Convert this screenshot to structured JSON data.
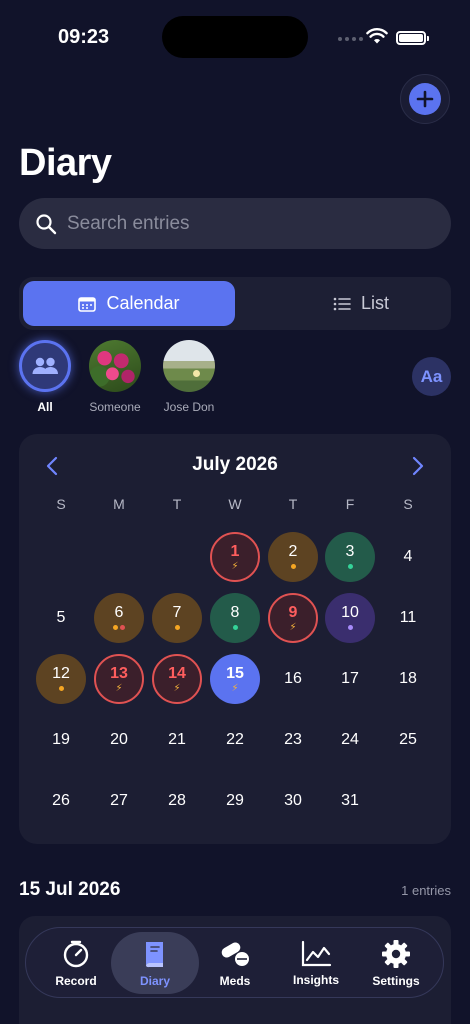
{
  "status": {
    "time": "09:23"
  },
  "header": {
    "title": "Diary"
  },
  "search": {
    "placeholder": "Search entries"
  },
  "view_toggle": {
    "calendar_label": "Calendar",
    "list_label": "List",
    "selected": "Calendar"
  },
  "people": [
    {
      "label": "All",
      "icon": "people-icon",
      "selected": true
    },
    {
      "label": "Someone",
      "icon": "flowers-photo"
    },
    {
      "label": "Jose Don",
      "icon": "meadow-photo"
    }
  ],
  "font_button": {
    "label": "Aa"
  },
  "calendar": {
    "month_label": "July 2026",
    "weekdays": [
      "S",
      "M",
      "T",
      "W",
      "T",
      "F",
      "S"
    ],
    "days": [
      {
        "day": "1",
        "style": "red",
        "marker": "bolt"
      },
      {
        "day": "2",
        "style": "amber",
        "marker": "dot",
        "dots": [
          "#f5a623"
        ]
      },
      {
        "day": "3",
        "style": "green",
        "marker": "dot",
        "dots": [
          "#34d399"
        ]
      },
      {
        "day": "4",
        "style": "plain"
      },
      {
        "day": "5",
        "style": "plain"
      },
      {
        "day": "6",
        "style": "amber",
        "marker": "dot",
        "dots": [
          "#f5a623",
          "#e05252"
        ]
      },
      {
        "day": "7",
        "style": "amber",
        "marker": "dot",
        "dots": [
          "#f5a623"
        ]
      },
      {
        "day": "8",
        "style": "green",
        "marker": "dot",
        "dots": [
          "#34d399"
        ]
      },
      {
        "day": "9",
        "style": "red",
        "marker": "bolt"
      },
      {
        "day": "10",
        "style": "purple",
        "marker": "dot",
        "dots": [
          "#a78bfa"
        ]
      },
      {
        "day": "11",
        "style": "plain"
      },
      {
        "day": "12",
        "style": "amber",
        "marker": "dot",
        "dots": [
          "#f5a623"
        ]
      },
      {
        "day": "13",
        "style": "red",
        "marker": "bolt"
      },
      {
        "day": "14",
        "style": "red",
        "marker": "bolt"
      },
      {
        "day": "15",
        "style": "today",
        "marker": "bolt"
      },
      {
        "day": "16",
        "style": "plain"
      },
      {
        "day": "17",
        "style": "plain"
      },
      {
        "day": "18",
        "style": "plain"
      },
      {
        "day": "19",
        "style": "plain"
      },
      {
        "day": "20",
        "style": "plain"
      },
      {
        "day": "21",
        "style": "plain"
      },
      {
        "day": "22",
        "style": "plain"
      },
      {
        "day": "23",
        "style": "plain"
      },
      {
        "day": "24",
        "style": "plain"
      },
      {
        "day": "25",
        "style": "plain"
      },
      {
        "day": "26",
        "style": "plain"
      },
      {
        "day": "27",
        "style": "plain"
      },
      {
        "day": "28",
        "style": "plain"
      },
      {
        "day": "29",
        "style": "plain"
      },
      {
        "day": "30",
        "style": "plain"
      },
      {
        "day": "31",
        "style": "plain"
      }
    ]
  },
  "section": {
    "date": "15 Jul 2026",
    "count": "1 entries"
  },
  "tabs": [
    {
      "label": "Record",
      "icon": "timer-icon"
    },
    {
      "label": "Diary",
      "icon": "book-icon",
      "active": true
    },
    {
      "label": "Meds",
      "icon": "pills-icon"
    },
    {
      "label": "Insights",
      "icon": "chart-icon"
    },
    {
      "label": "Settings",
      "icon": "gear-icon"
    }
  ],
  "colors": {
    "accent": "#5b73f0",
    "background": "#11132a",
    "card": "#1c1e33",
    "alert": "#e05252"
  }
}
